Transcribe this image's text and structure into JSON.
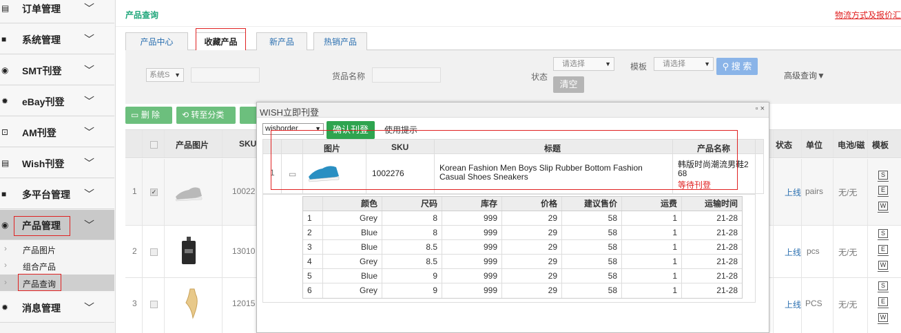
{
  "sidebar": {
    "menus": [
      {
        "label": "订单管理",
        "icon": "list-icon"
      },
      {
        "label": "系统管理",
        "icon": "folder-icon"
      },
      {
        "label": "SMT刊登",
        "icon": "target-icon"
      },
      {
        "label": "eBay刊登",
        "icon": "gear-icon"
      },
      {
        "label": "AM刊登",
        "icon": "chart-icon"
      },
      {
        "label": "Wish刊登",
        "icon": "list-icon"
      },
      {
        "label": "多平台管理",
        "icon": "folder-icon"
      },
      {
        "label": "产品管理",
        "icon": "target-icon"
      },
      {
        "label": "消息管理",
        "icon": "gear-icon"
      }
    ],
    "submenus": [
      {
        "label": "产品图片"
      },
      {
        "label": "组合产品"
      },
      {
        "label": "产品查询"
      }
    ]
  },
  "header": {
    "breadcrumb": "产品查询",
    "top_link": "物流方式及报价汇"
  },
  "tabs": [
    {
      "label": "产品中心"
    },
    {
      "label": "收藏产品"
    },
    {
      "label": "新产品"
    },
    {
      "label": "热销产品"
    }
  ],
  "filter": {
    "system_select": "系统S",
    "goods_name_label": "货品名称",
    "status_label": "状态",
    "status_select": "请选择",
    "template_label": "模板",
    "template_select": "请选择",
    "search_button": "搜 索",
    "clear_button": "清空",
    "advanced": "高级查询▼"
  },
  "actions": {
    "delete": "删 除",
    "move": "转至分类"
  },
  "product_table": {
    "headers": {
      "image": "产品图片",
      "sku": "SKU",
      "status": "状态",
      "unit": "单位",
      "battery": "电池/磁",
      "template": "模板"
    },
    "rows": [
      {
        "index": "1",
        "sku": "10022",
        "status": "上线",
        "unit": "pairs",
        "battery": "无/无",
        "checked": true
      },
      {
        "index": "2",
        "sku": "13010",
        "status": "上线",
        "unit": "pcs",
        "battery": "无/无",
        "checked": false
      },
      {
        "index": "3",
        "sku": "12015",
        "status": "上线",
        "unit": "PCS",
        "battery": "无/无",
        "checked": false
      }
    ],
    "template_icons": [
      "S",
      "E",
      "W"
    ]
  },
  "dialog": {
    "title": "WISH立即刊登",
    "controls": "▫ ×",
    "account_select": "wishorder",
    "confirm_button": "确认刊登",
    "hint": "使用提示",
    "item_headers": {
      "image": "图片",
      "sku": "SKU",
      "title": "标题",
      "name": "产品名称"
    },
    "item": {
      "index": "1",
      "sku": "1002276",
      "title": "Korean Fashion Men Boys Slip Rubber Bottom Fashion Casual Shoes Sneakers",
      "name": "韩版时尚潮流男鞋268",
      "status": "等待刊登"
    },
    "variant_headers": [
      "颜色",
      "尺码",
      "库存",
      "价格",
      "建议售价",
      "运费",
      "运输时间"
    ],
    "variants": [
      {
        "i": "1",
        "color": "Grey",
        "size": "8",
        "stock": "999",
        "price": "29",
        "suggested": "58",
        "shipping": "1",
        "time": "21-28"
      },
      {
        "i": "2",
        "color": "Blue",
        "size": "8",
        "stock": "999",
        "price": "29",
        "suggested": "58",
        "shipping": "1",
        "time": "21-28"
      },
      {
        "i": "3",
        "color": "Blue",
        "size": "8.5",
        "stock": "999",
        "price": "29",
        "suggested": "58",
        "shipping": "1",
        "time": "21-28"
      },
      {
        "i": "4",
        "color": "Grey",
        "size": "8.5",
        "stock": "999",
        "price": "29",
        "suggested": "58",
        "shipping": "1",
        "time": "21-28"
      },
      {
        "i": "5",
        "color": "Blue",
        "size": "9",
        "stock": "999",
        "price": "29",
        "suggested": "58",
        "shipping": "1",
        "time": "21-28"
      },
      {
        "i": "6",
        "color": "Grey",
        "size": "9",
        "stock": "999",
        "price": "29",
        "suggested": "58",
        "shipping": "1",
        "time": "21-28"
      }
    ]
  },
  "colors": {
    "accent_green": "#1fa67a",
    "link_blue": "#2a6fb0",
    "highlight_red": "#e02020",
    "confirm_green": "#2ea44f"
  }
}
